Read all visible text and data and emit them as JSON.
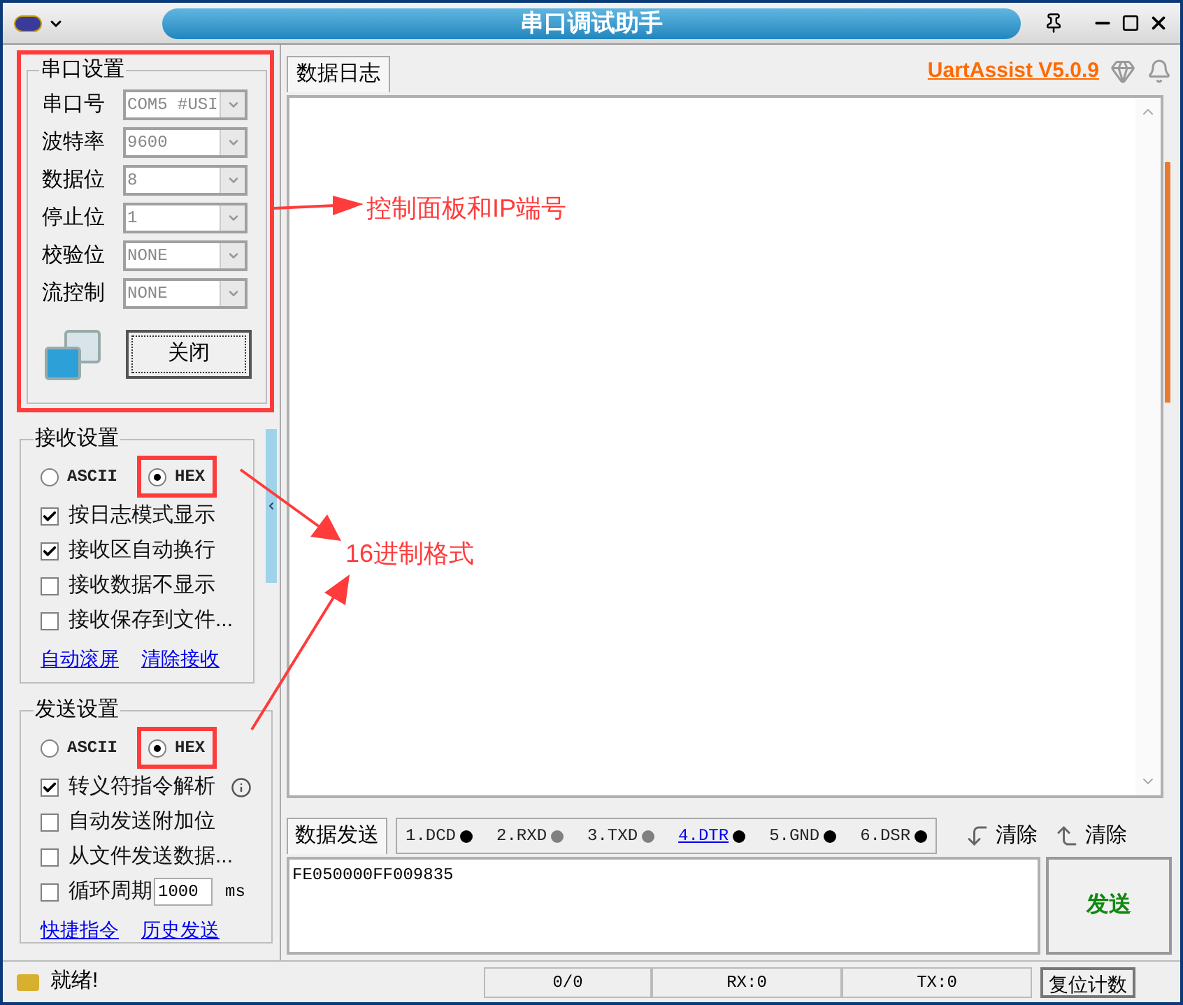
{
  "window": {
    "title": "串口调试助手"
  },
  "serial_settings": {
    "title": "串口设置",
    "fields": [
      {
        "label": "串口号",
        "value": "COM5 #USI"
      },
      {
        "label": "波特率",
        "value": "9600"
      },
      {
        "label": "数据位",
        "value": "8"
      },
      {
        "label": "停止位",
        "value": "1"
      },
      {
        "label": "校验位",
        "value": "NONE"
      },
      {
        "label": "流控制",
        "value": "NONE"
      }
    ],
    "button": "关闭"
  },
  "receive_settings": {
    "title": "接收设置",
    "modes": [
      {
        "label": "ASCII",
        "selected": false,
        "annotated": false
      },
      {
        "label": "HEX",
        "selected": true,
        "annotated": true
      }
    ],
    "options": [
      {
        "kind": "plain",
        "label": "按日志模式显示",
        "checked": true
      },
      {
        "kind": "plain",
        "label": "接收区自动换行",
        "checked": true
      },
      {
        "kind": "plain",
        "label": "接收数据不显示",
        "checked": false
      },
      {
        "kind": "plain",
        "label": "接收保存到文件...",
        "checked": false
      }
    ],
    "links": [
      "自动滚屏",
      "清除接收"
    ]
  },
  "send_settings": {
    "title": "发送设置",
    "modes": [
      {
        "label": "ASCII",
        "selected": false,
        "annotated": false
      },
      {
        "label": "HEX",
        "selected": true,
        "annotated": true
      }
    ],
    "options": [
      {
        "kind": "info",
        "label": "转义符指令解析",
        "checked": true
      },
      {
        "kind": "plain",
        "label": "自动发送附加位",
        "checked": false
      },
      {
        "kind": "plain",
        "label": "从文件发送数据...",
        "checked": false
      },
      {
        "kind": "period",
        "label": "循环周期",
        "checked": false,
        "value": "1000",
        "unit": "ms"
      }
    ],
    "links": [
      "快捷指令",
      "历史发送"
    ]
  },
  "log": {
    "tab": "数据日志",
    "brand_link": "UartAssist V5.0.9"
  },
  "send": {
    "tab": "数据发送",
    "pins": [
      {
        "label": "1.DCD",
        "color": "#000000",
        "selected": false
      },
      {
        "label": "2.RXD",
        "color": "#808080",
        "selected": false
      },
      {
        "label": "3.TXD",
        "color": "#808080",
        "selected": false
      },
      {
        "label": "4.DTR",
        "color": "#000000",
        "selected": true
      },
      {
        "label": "5.GND",
        "color": "#000000",
        "selected": false
      },
      {
        "label": "6.DSR",
        "color": "#000000",
        "selected": false
      }
    ],
    "clear_buttons": [
      "清除",
      "清除"
    ],
    "input": "FE050000FF009835",
    "send_button": "发送"
  },
  "status_bar": {
    "text": "就绪!",
    "fields": [
      "0/0",
      "RX:0",
      "TX:0"
    ],
    "reset_button": "复位计数"
  },
  "annotations": [
    "控制面板和IP端号",
    "16进制格式"
  ]
}
